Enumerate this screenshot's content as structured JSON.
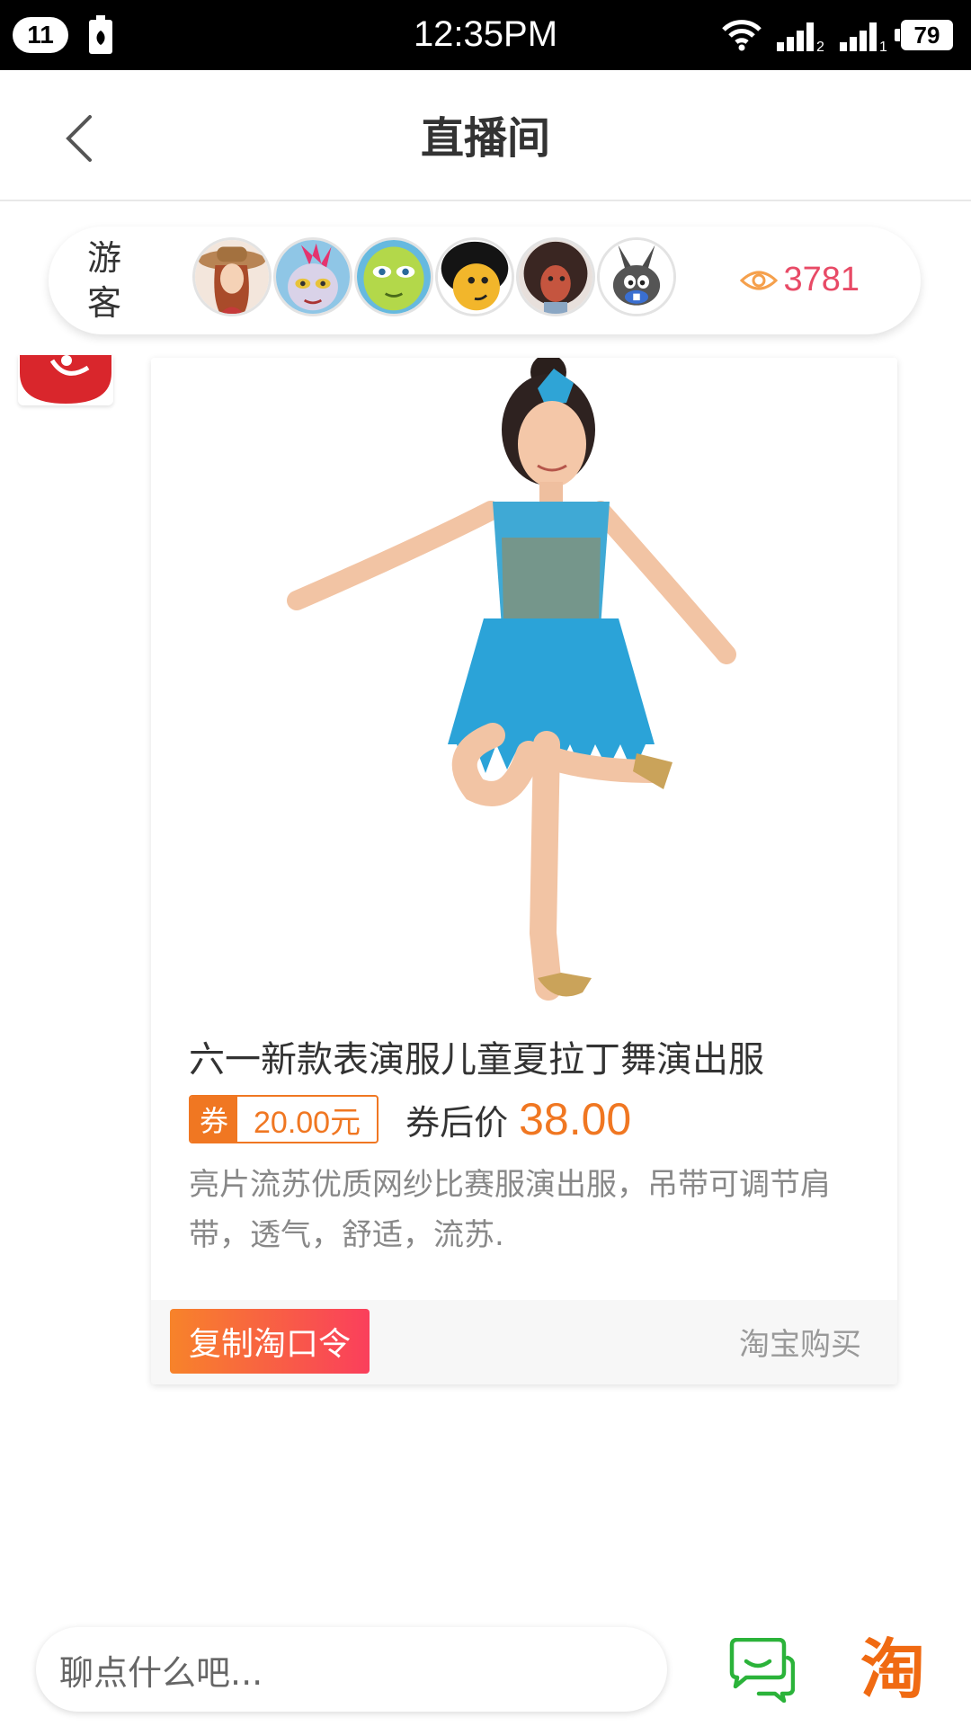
{
  "status_bar": {
    "notification_count": "11",
    "time": "12:35PM",
    "sim1_label": "2",
    "sim2_label": "1",
    "battery": "79"
  },
  "header": {
    "title": "直播间",
    "back_icon": "chevron-left-icon"
  },
  "viewers": {
    "guest_label": "游客",
    "count": "3781",
    "count_color": "#e84a66",
    "eye_icon": "eye-icon",
    "avatar_icons": [
      "cowgirl-avatar",
      "punk-avatar",
      "green-alien-avatar",
      "cartoon-boy-avatar",
      "afro-avatar",
      "rabbit-avatar"
    ]
  },
  "product": {
    "title": "六一新款表演服儿童夏拉丁舞演出服",
    "coupon_tag": "券",
    "coupon_value": "20.00元",
    "after_coupon_label": "券后价",
    "after_coupon_price": "38.00",
    "description": "亮片流苏优质网纱比赛服演出服，吊带可调节肩带，透气，舒适，流苏.",
    "accent_color": "#f07722"
  },
  "actions": {
    "copy_label": "复制淘口令",
    "buy_label": "淘宝购买"
  },
  "bottom_bar": {
    "chat_placeholder": "聊点什么吧...",
    "taobao_glyph": "淘"
  }
}
